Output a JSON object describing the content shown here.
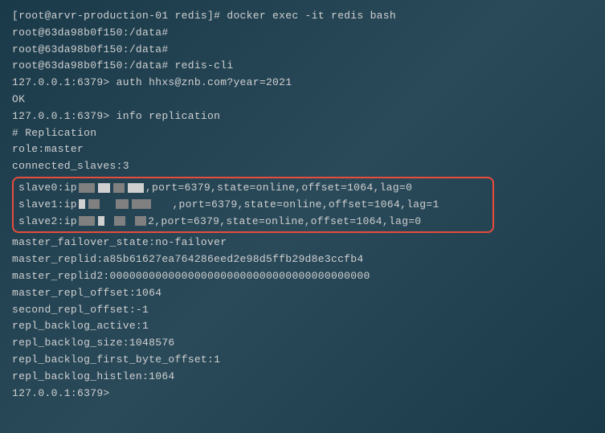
{
  "lines": {
    "l1": "[root@arvr-production-01 redis]# docker exec -it redis bash",
    "l2": "root@63da98b0f150:/data#",
    "l3": "root@63da98b0f150:/data#",
    "l4": "root@63da98b0f150:/data# redis-cli",
    "l5": "127.0.0.1:6379> auth hhxs@znb.com?year=2021",
    "l6": "OK",
    "l7": "127.0.0.1:6379> info replication",
    "l8": "# Replication",
    "l9": "role:master",
    "l10": "connected_slaves:3",
    "l14": "master_failover_state:no-failover",
    "l15": "master_replid:a85b61627ea764286eed2e98d5ffb29d8e3ccfb4",
    "l16": "master_replid2:0000000000000000000000000000000000000000",
    "l17": "master_repl_offset:1064",
    "l18": "second_repl_offset:-1",
    "l19": "repl_backlog_active:1",
    "l20": "repl_backlog_size:1048576",
    "l21": "repl_backlog_first_byte_offset:1",
    "l22": "repl_backlog_histlen:1064",
    "l23": "127.0.0.1:6379>"
  },
  "slaves": {
    "s0_prefix": "slave0:ip",
    "s0_suffix": ",port=6379,state=online,offset=1064,lag=0",
    "s1_prefix": "slave1:ip",
    "s1_suffix": ",port=6379,state=online,offset=1064,lag=1",
    "s2_prefix": "slave2:ip",
    "s2_suffix": "2,port=6379,state=online,offset=1064,lag=0"
  }
}
